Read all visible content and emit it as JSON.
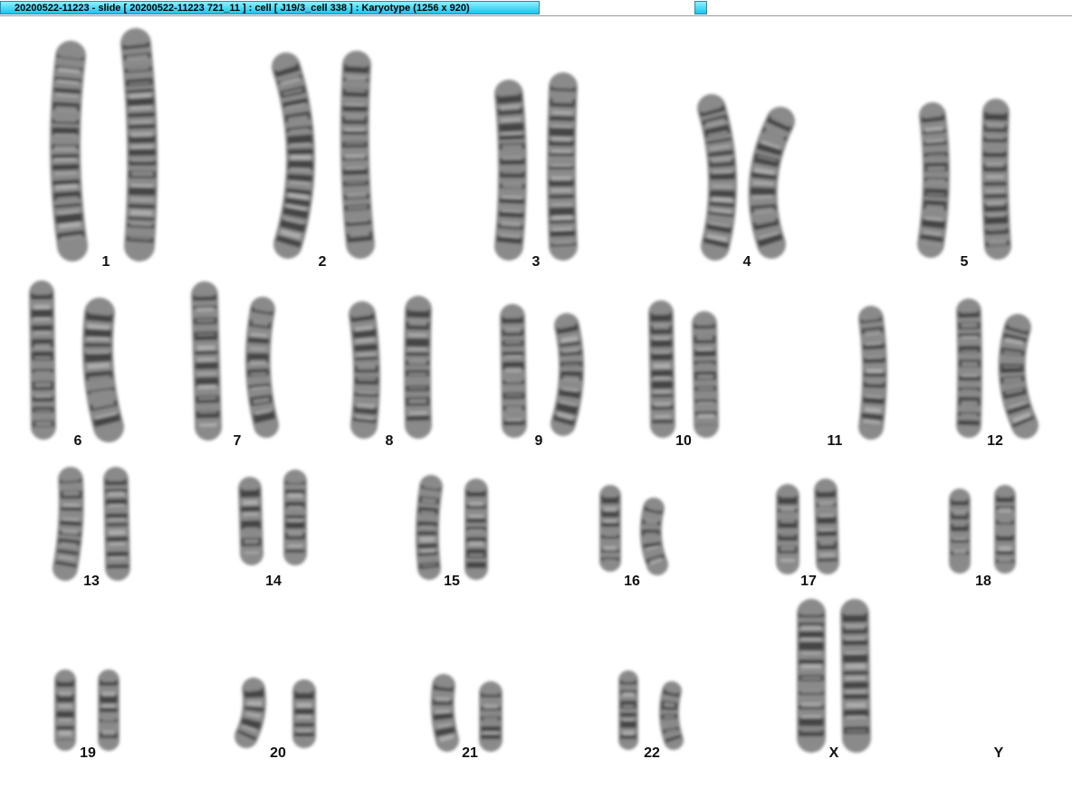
{
  "window": {
    "title": "20200522-11223 - slide [ 20200522-11223 721_11 ] : cell [ J19/3_cell 338 ] : Karyotype  (1256 x 920)"
  },
  "karyotype": {
    "labels": [
      "1",
      "2",
      "3",
      "4",
      "5",
      "6",
      "7",
      "8",
      "9",
      "10",
      "11",
      "12",
      "13",
      "14",
      "15",
      "16",
      "17",
      "18",
      "19",
      "20",
      "21",
      "22",
      "X",
      "Y"
    ]
  }
}
